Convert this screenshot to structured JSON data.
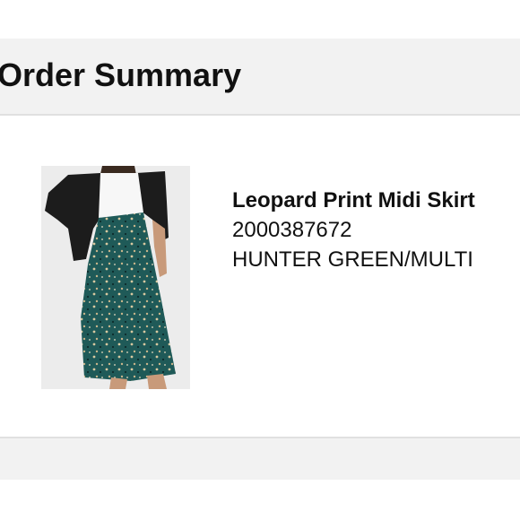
{
  "header": {
    "title": "Order Summary"
  },
  "product": {
    "name": "Leopard Print Midi Skirt",
    "sku": "2000387672",
    "color": "HUNTER GREEN/MULTI",
    "image_icon": "skirt-photo"
  }
}
